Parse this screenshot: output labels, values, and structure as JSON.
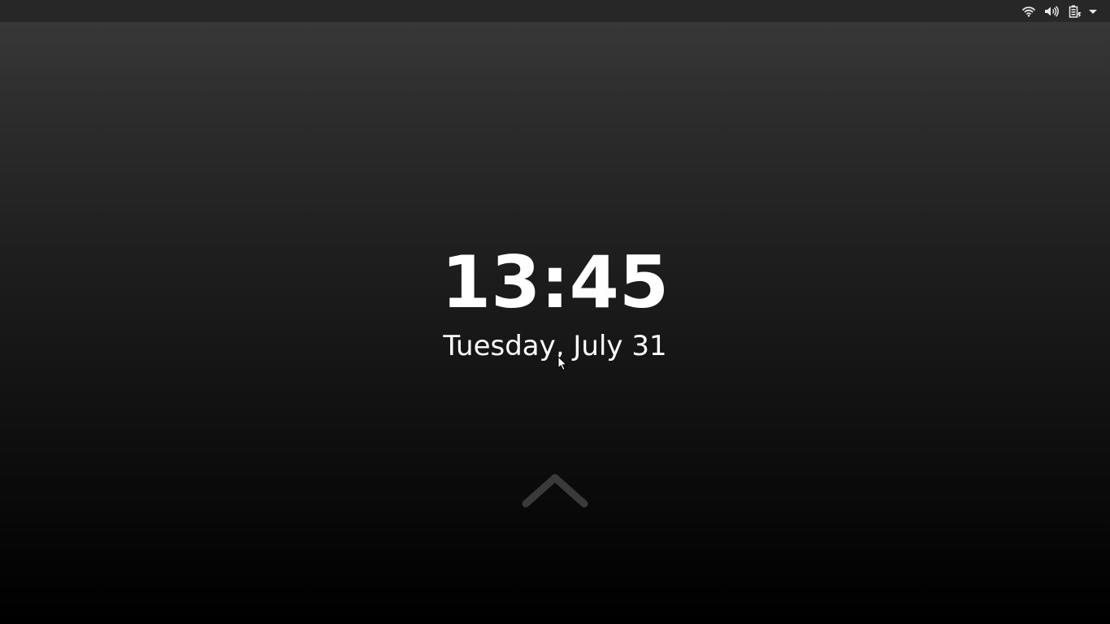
{
  "top_bar": {
    "icons": {
      "wifi": "wifi-icon",
      "volume": "volume-icon",
      "battery": "battery-charging-icon",
      "menu": "chevron-down-icon"
    }
  },
  "lock_screen": {
    "time": "13:45",
    "date": "Tuesday, July 31",
    "unlock_icon": "chevron-up-icon"
  },
  "colors": {
    "top_bar": "#272727",
    "text": "#ffffff",
    "chevron": "#3a3a3a"
  }
}
